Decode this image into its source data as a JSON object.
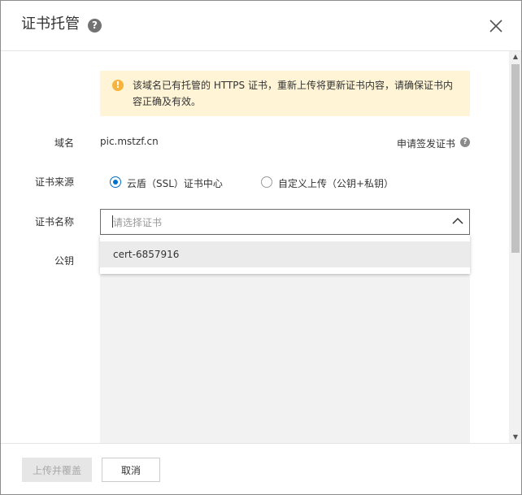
{
  "dialog": {
    "title": "证书托管",
    "help_icon": "question-circle-icon",
    "close_icon": "close-icon"
  },
  "notice": {
    "icon": "warning-circle-icon",
    "text": "该域名已有托管的 HTTPS 证书，重新上传将更新证书内容，请确保证书内容正确及有效。"
  },
  "form": {
    "domain": {
      "label": "域名",
      "value": "pic.mstzf.cn",
      "apply_link": "申请签发证书"
    },
    "cert_source": {
      "label": "证书来源",
      "options": [
        {
          "label": "云盾（SSL）证书中心",
          "checked": true
        },
        {
          "label": "自定义上传（公钥+私钥）",
          "checked": false
        }
      ]
    },
    "cert_name": {
      "label": "证书名称",
      "placeholder": "请选择证书",
      "options": [
        "cert-6857916"
      ]
    },
    "public_key": {
      "label": "公钥"
    }
  },
  "footer": {
    "submit_label": "上传并覆盖",
    "cancel_label": "取消"
  },
  "colors": {
    "accent": "#0070cc",
    "notice_bg": "#fff5d6",
    "warning": "#f6b33d"
  }
}
